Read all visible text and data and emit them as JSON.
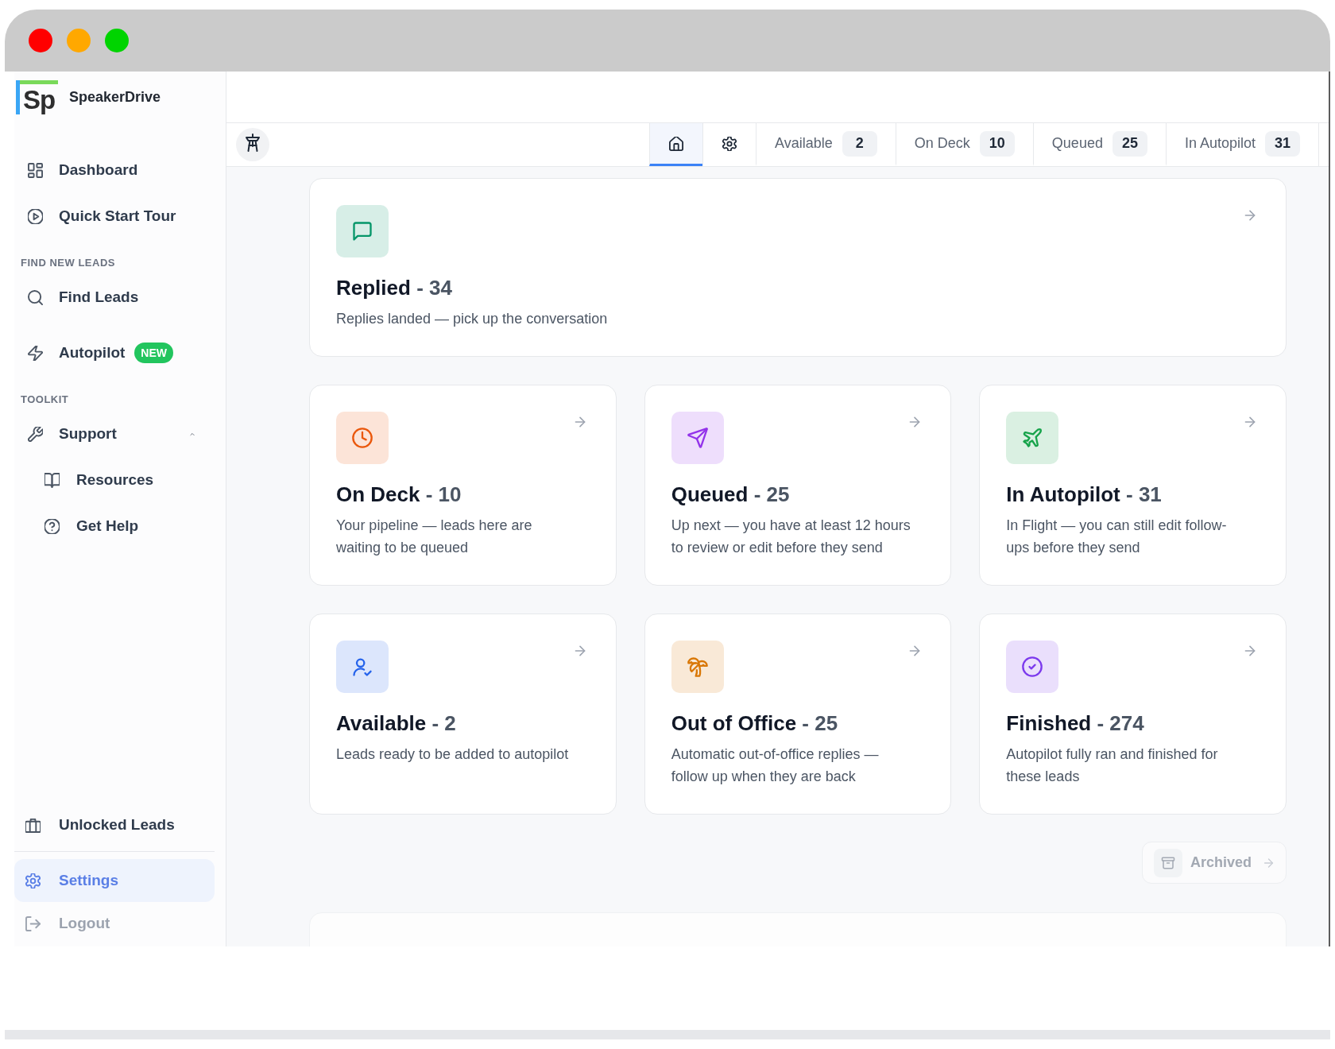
{
  "sidebar": {
    "logo_text": "Sp",
    "brand": "SpeakerDrive",
    "groups": [
      {
        "items": [
          {
            "label": "Dashboard",
            "selected": false
          },
          {
            "label": "Quick Start Tour",
            "selected": false
          }
        ]
      },
      {
        "heading": "FIND NEW LEADS",
        "items": [
          {
            "label": "Find Leads",
            "selected": false
          },
          {
            "label": "Autopilot",
            "badge": "NEW",
            "selected": false
          }
        ]
      },
      {
        "heading": "TOOLKIT",
        "items": [
          {
            "label": "Support",
            "selected": false,
            "expanded": true,
            "children": [
              {
                "label": "Resources",
                "selected": false
              },
              {
                "label": "Get Help",
                "selected": false
              }
            ]
          }
        ]
      }
    ],
    "footer_items": [
      {
        "label": "Unlocked Leads",
        "kind": "nav",
        "selected": false
      },
      {
        "label": "Settings",
        "kind": "nav",
        "selected": true
      },
      {
        "label": "Logout",
        "kind": "action",
        "selected": false
      }
    ]
  },
  "tabs": [
    {
      "kind": "icon",
      "selected": true
    },
    {
      "kind": "icon",
      "selected": false
    },
    {
      "kind": "count",
      "label": "Available",
      "count": "2",
      "selected": false
    },
    {
      "kind": "count",
      "label": "On Deck",
      "count": "10",
      "selected": false
    },
    {
      "kind": "count",
      "label": "Queued",
      "count": "25",
      "selected": false
    },
    {
      "kind": "count",
      "label": "In Autopilot",
      "count": "31",
      "selected": false
    }
  ],
  "featured_card": {
    "title": "Replied",
    "count": "- 34",
    "description": "Replies landed — pick up the conversation",
    "color": "#059669"
  },
  "cards": [
    {
      "title": "On Deck",
      "count": "- 10",
      "description": "Your pipeline — leads here are waiting to be queued",
      "color": "#ea580c"
    },
    {
      "title": "Queued",
      "count": "- 25",
      "description": "Up next — you have at least 12 hours to review or edit before they send",
      "color": "#9333ea"
    },
    {
      "title": "In Autopilot",
      "count": "- 31",
      "description": "In Flight — you can still edit follow-ups before they send",
      "color": "#16a34a"
    },
    {
      "title": "Available",
      "count": "- 2",
      "description": "Leads ready to be added to autopilot",
      "color": "#2563eb"
    },
    {
      "title": "Out of Office",
      "count": "- 25",
      "description": "Automatic out-of-office replies — follow up when they are back",
      "color": "#d97706"
    },
    {
      "title": "Finished",
      "count": "- 274",
      "description": "Autopilot fully ran and finished for these leads",
      "color": "#7c3aed"
    }
  ],
  "archived": {
    "label": "Archived"
  }
}
